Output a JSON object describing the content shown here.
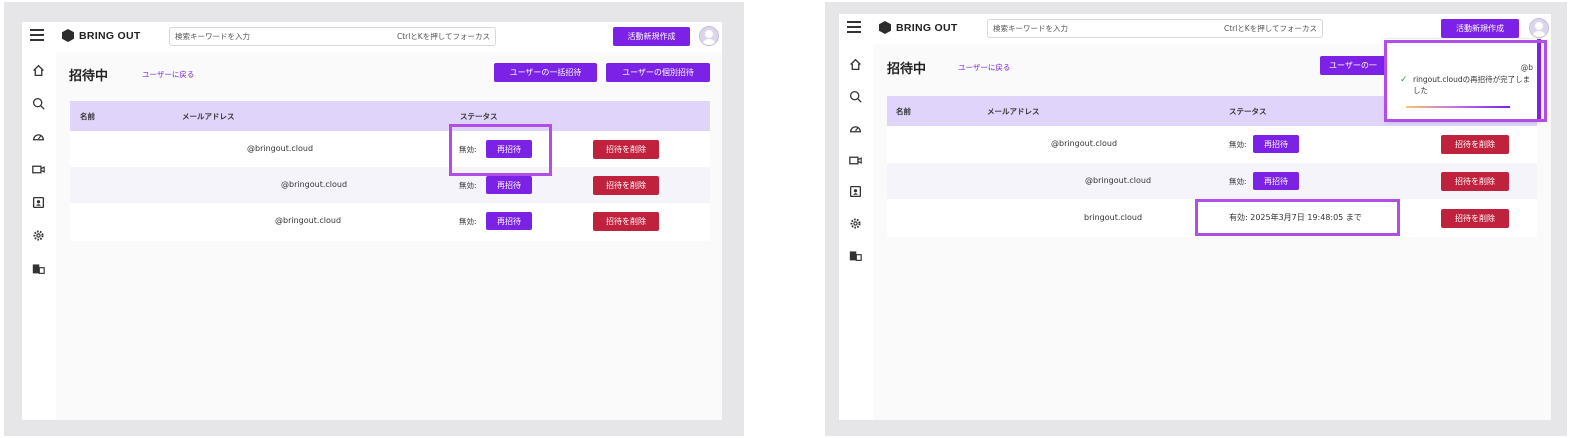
{
  "brand": {
    "name": "BRING OUT"
  },
  "search": {
    "placeholder": "検索キーワードを入力",
    "shortcut_hint": "CtrlとKを押してフォーカス"
  },
  "header": {
    "create_activity_label": "活動新規作成"
  },
  "page": {
    "title": "招待中",
    "back_link": "ユーザーに戻る",
    "bulk_invite_label": "ユーザーの一括招待",
    "bulk_invite_label_cut": "ユーザーの一",
    "individual_invite_label": "ユーザーの個別招待"
  },
  "table": {
    "headers": {
      "name": "名前",
      "email": "メールアドレス",
      "status": "ステータス"
    },
    "reinvite_label": "再招待",
    "delete_label": "招待を削除",
    "status_invalid": "無効:"
  },
  "left_rows": [
    {
      "email": "@bringout.cloud"
    },
    {
      "email": "@bringout.cloud"
    },
    {
      "email": "@bringout.cloud"
    }
  ],
  "right_rows": [
    {
      "email": "@bringout.cloud"
    },
    {
      "email": "@bringout.cloud"
    },
    {
      "email": "bringout.cloud",
      "status_valid": "有効: 2025年3月7日 19:48:05 まで"
    }
  ],
  "toast": {
    "user_fragment": "@b",
    "message": "ringout.cloudの再招待が完了しました"
  },
  "sidebar_icons": [
    "home-icon",
    "search-icon",
    "dashboard-icon",
    "video-icon",
    "id-card-icon",
    "settings-icon",
    "building-icon"
  ],
  "colors": {
    "accent": "#7b22e6",
    "danger": "#c0223e",
    "table_header": "#e0d4fa",
    "highlight": "#b04ee8"
  }
}
